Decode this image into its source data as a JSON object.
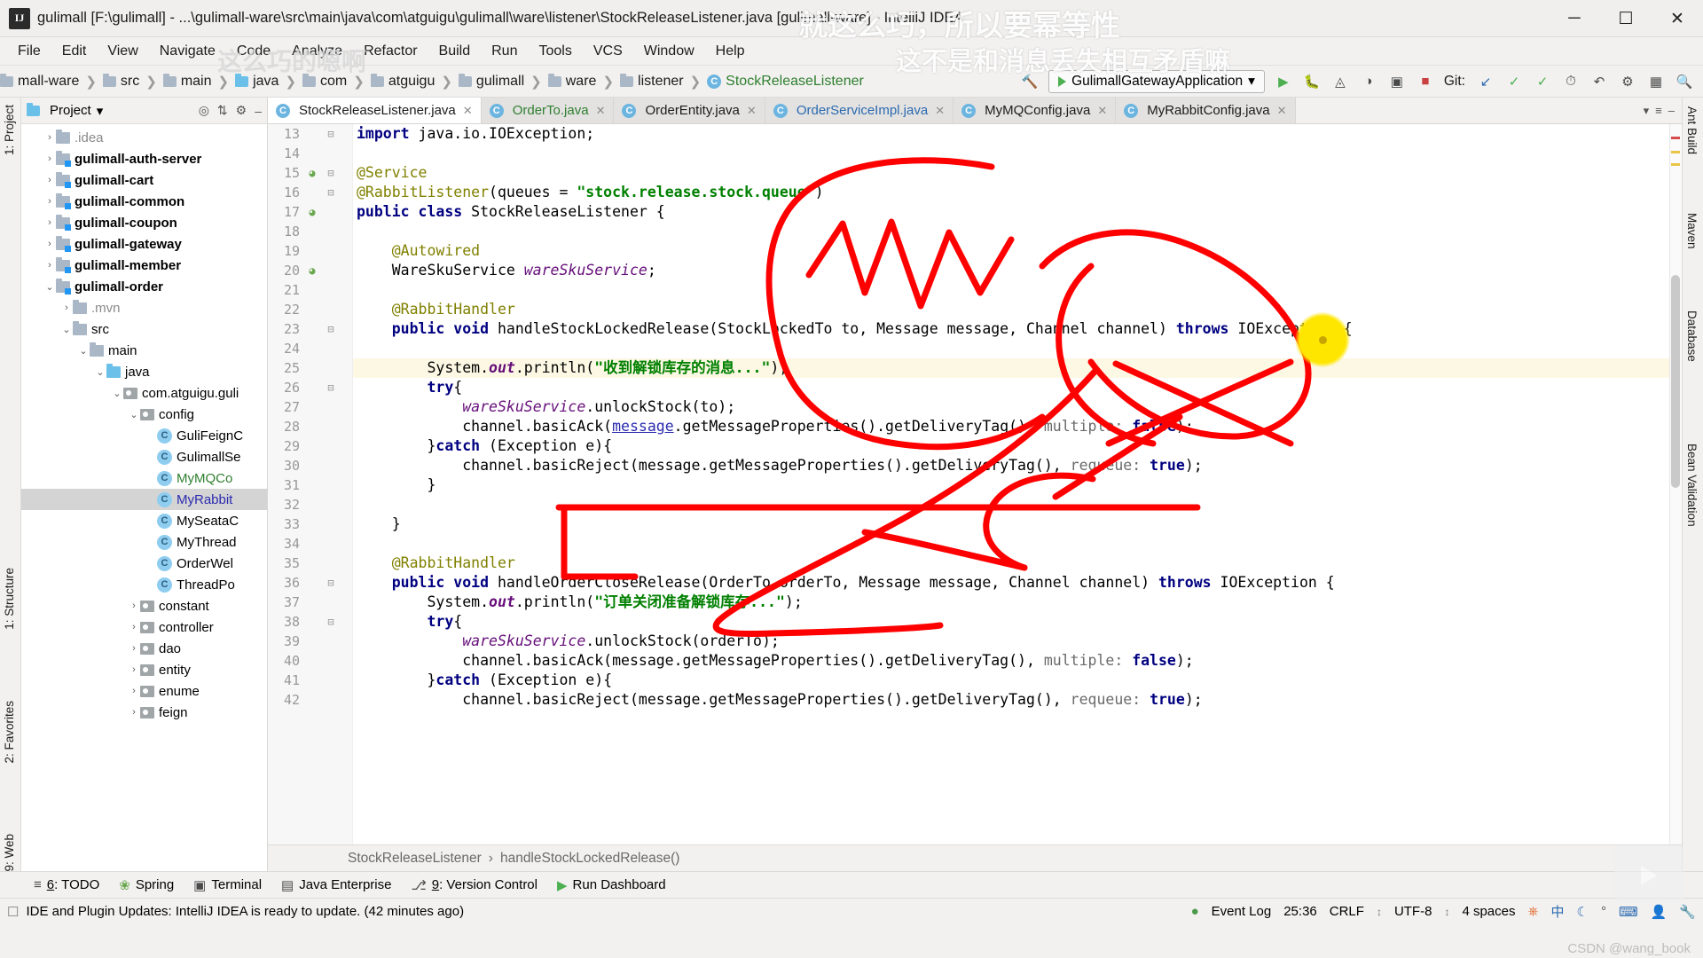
{
  "window": {
    "title": "gulimall [F:\\gulimall] - ...\\gulimall-ware\\src\\main\\java\\com\\atguigu\\gulimall\\ware\\listener\\StockReleaseListener.java [gulimall-ware] - IntelliJ IDEA",
    "logo": "IJ",
    "minimize": "─",
    "maximize": "☐",
    "close": "✕"
  },
  "menubar": [
    {
      "label": "File"
    },
    {
      "label": "Edit"
    },
    {
      "label": "View"
    },
    {
      "label": "Navigate"
    },
    {
      "label": "Code"
    },
    {
      "label": "Analyze"
    },
    {
      "label": "Refactor"
    },
    {
      "label": "Build"
    },
    {
      "label": "Run"
    },
    {
      "label": "Tools"
    },
    {
      "label": "VCS"
    },
    {
      "label": "Window"
    },
    {
      "label": "Help"
    }
  ],
  "breadcrumb": {
    "items": [
      {
        "label": "mall-ware",
        "icon": "module-folder-icon"
      },
      {
        "label": "src",
        "icon": "folder-icon"
      },
      {
        "label": "main",
        "icon": "folder-icon"
      },
      {
        "label": "java",
        "icon": "source-folder-icon"
      },
      {
        "label": "com",
        "icon": "package-icon"
      },
      {
        "label": "atguigu",
        "icon": "package-icon"
      },
      {
        "label": "gulimall",
        "icon": "package-icon"
      },
      {
        "label": "ware",
        "icon": "package-icon"
      },
      {
        "label": "listener",
        "icon": "package-icon"
      },
      {
        "label": "StockReleaseListener",
        "icon": "class-icon"
      }
    ],
    "separator": "❯"
  },
  "toolbar": {
    "run_config": "GulimallGatewayApplication",
    "run_config_dropdown": "▾",
    "build_icon": "hammer-icon",
    "run_icon": "run-icon",
    "debug_icon": "debug-icon",
    "coverage_icon": "coverage-icon",
    "profile_icon": "profile-icon",
    "stop_icon": "stop-icon",
    "git_label": "Git:",
    "update_icon": "update-project-icon",
    "commit_icon": "commit-icon",
    "push_icon": "push-icon",
    "history_icon": "history-icon",
    "revert_icon": "revert-icon",
    "settings_icon": "settings-icon",
    "layout_icon": "layout-icon",
    "search_icon": "search-icon"
  },
  "left_strip": [
    {
      "label": "1: Project"
    },
    {
      "label": "1: Structure"
    },
    {
      "label": "2: Favorites"
    },
    {
      "label": "9: Web"
    }
  ],
  "right_strip": [
    {
      "label": "Ant Build"
    },
    {
      "label": "Maven"
    },
    {
      "label": "Database"
    },
    {
      "label": "Bean Validation"
    }
  ],
  "project_panel": {
    "title": "Project",
    "title_dropdown": "▾",
    "locate_icon": "locate-icon",
    "collapse_icon": "collapse-all-icon",
    "gear_icon": "gear-icon",
    "hide_icon": "hide-icon",
    "tree": [
      {
        "label": ".idea",
        "indent": 1,
        "arrow": "›",
        "icon": "folder-icon",
        "style": "grey"
      },
      {
        "label": "gulimall-auth-server",
        "indent": 1,
        "arrow": "›",
        "icon": "module-icon",
        "style": "bold"
      },
      {
        "label": "gulimall-cart",
        "indent": 1,
        "arrow": "›",
        "icon": "module-icon",
        "style": "bold"
      },
      {
        "label": "gulimall-common",
        "indent": 1,
        "arrow": "›",
        "icon": "module-icon",
        "style": "bold"
      },
      {
        "label": "gulimall-coupon",
        "indent": 1,
        "arrow": "›",
        "icon": "module-icon",
        "style": "bold"
      },
      {
        "label": "gulimall-gateway",
        "indent": 1,
        "arrow": "›",
        "icon": "module-icon",
        "style": "bold"
      },
      {
        "label": "gulimall-member",
        "indent": 1,
        "arrow": "›",
        "icon": "module-icon",
        "style": "bold"
      },
      {
        "label": "gulimall-order",
        "indent": 1,
        "arrow": "⌄",
        "icon": "module-icon",
        "style": "bold"
      },
      {
        "label": ".mvn",
        "indent": 2,
        "arrow": "›",
        "icon": "folder-icon",
        "style": "grey"
      },
      {
        "label": "src",
        "indent": 2,
        "arrow": "⌄",
        "icon": "folder-icon",
        "style": "normal"
      },
      {
        "label": "main",
        "indent": 3,
        "arrow": "⌄",
        "icon": "folder-icon",
        "style": "normal"
      },
      {
        "label": "java",
        "indent": 4,
        "arrow": "⌄",
        "icon": "source-folder-icon",
        "style": "normal"
      },
      {
        "label": "com.atguigu.guli",
        "indent": 5,
        "arrow": "⌄",
        "icon": "package-icon",
        "style": "normal"
      },
      {
        "label": "config",
        "indent": 6,
        "arrow": "⌄",
        "icon": "package-icon",
        "style": "normal"
      },
      {
        "label": "GuliFeignC",
        "indent": 7,
        "arrow": "",
        "icon": "class-icon",
        "style": "normal"
      },
      {
        "label": "GulimallSe",
        "indent": 7,
        "arrow": "",
        "icon": "class-icon",
        "style": "normal"
      },
      {
        "label": "MyMQCo",
        "indent": 7,
        "arrow": "",
        "icon": "class-icon",
        "style": "green"
      },
      {
        "label": "MyRabbit",
        "indent": 7,
        "arrow": "",
        "icon": "class-icon",
        "style": "blue",
        "selected": true
      },
      {
        "label": "MySeataC",
        "indent": 7,
        "arrow": "",
        "icon": "class-icon",
        "style": "normal"
      },
      {
        "label": "MyThread",
        "indent": 7,
        "arrow": "",
        "icon": "class-icon",
        "style": "normal"
      },
      {
        "label": "OrderWel",
        "indent": 7,
        "arrow": "",
        "icon": "class-icon",
        "style": "normal"
      },
      {
        "label": "ThreadPo",
        "indent": 7,
        "arrow": "",
        "icon": "class-icon",
        "style": "normal"
      },
      {
        "label": "constant",
        "indent": 6,
        "arrow": "›",
        "icon": "package-icon",
        "style": "normal"
      },
      {
        "label": "controller",
        "indent": 6,
        "arrow": "›",
        "icon": "package-icon",
        "style": "normal"
      },
      {
        "label": "dao",
        "indent": 6,
        "arrow": "›",
        "icon": "package-icon",
        "style": "normal"
      },
      {
        "label": "entity",
        "indent": 6,
        "arrow": "›",
        "icon": "package-icon",
        "style": "normal"
      },
      {
        "label": "enume",
        "indent": 6,
        "arrow": "›",
        "icon": "package-icon",
        "style": "normal"
      },
      {
        "label": "feign",
        "indent": 6,
        "arrow": "›",
        "icon": "package-icon",
        "style": "normal"
      }
    ]
  },
  "editor_tabs": [
    {
      "label": "StockReleaseListener.java",
      "active": true,
      "color": "normal",
      "close": "✕"
    },
    {
      "label": "OrderTo.java",
      "active": false,
      "color": "green",
      "close": "✕"
    },
    {
      "label": "OrderEntity.java",
      "active": false,
      "color": "normal",
      "close": "✕"
    },
    {
      "label": "OrderServiceImpl.java",
      "active": false,
      "color": "blue",
      "close": "✕"
    },
    {
      "label": "MyMQConfig.java",
      "active": false,
      "color": "normal",
      "close": "✕"
    },
    {
      "label": "MyRabbitConfig.java",
      "active": false,
      "color": "normal",
      "close": "✕"
    }
  ],
  "code": {
    "first_line_number": 13,
    "lines": [
      {
        "n": 13,
        "mark": "",
        "fold": "−",
        "highlight": false,
        "tokens": [
          {
            "t": "import ",
            "c": "kw"
          },
          {
            "t": "java.io.IOException;",
            "c": "plain"
          }
        ]
      },
      {
        "n": 14,
        "mark": "",
        "fold": "",
        "highlight": false,
        "tokens": []
      },
      {
        "n": 15,
        "mark": "bean-icon",
        "fold": "−",
        "highlight": false,
        "tokens": [
          {
            "t": "@Service",
            "c": "ann"
          }
        ]
      },
      {
        "n": 16,
        "mark": "",
        "fold": "−",
        "highlight": false,
        "tokens": [
          {
            "t": "@RabbitListener",
            "c": "ann"
          },
          {
            "t": "(queues = ",
            "c": "plain"
          },
          {
            "t": "\"stock.release.stock.queue\"",
            "c": "str"
          },
          {
            "t": ")",
            "c": "plain"
          }
        ]
      },
      {
        "n": 17,
        "mark": "bean-icon",
        "fold": "",
        "highlight": false,
        "tokens": [
          {
            "t": "public class ",
            "c": "kw"
          },
          {
            "t": "StockReleaseListener {",
            "c": "plain"
          }
        ]
      },
      {
        "n": 18,
        "mark": "",
        "fold": "",
        "highlight": false,
        "tokens": []
      },
      {
        "n": 19,
        "mark": "",
        "fold": "",
        "highlight": false,
        "tokens": [
          {
            "t": "    @Autowired",
            "c": "ann"
          }
        ]
      },
      {
        "n": 20,
        "mark": "bean-icon",
        "fold": "",
        "highlight": false,
        "tokens": [
          {
            "t": "    WareSkuService ",
            "c": "plain"
          },
          {
            "t": "wareSkuService",
            "c": "fld"
          },
          {
            "t": ";",
            "c": "plain"
          }
        ]
      },
      {
        "n": 21,
        "mark": "",
        "fold": "",
        "highlight": false,
        "tokens": []
      },
      {
        "n": 22,
        "mark": "",
        "fold": "",
        "highlight": false,
        "tokens": [
          {
            "t": "    @RabbitHandler",
            "c": "ann"
          }
        ]
      },
      {
        "n": 23,
        "mark": "",
        "fold": "−",
        "highlight": false,
        "tokens": [
          {
            "t": "    public void ",
            "c": "kw"
          },
          {
            "t": "handleStockLockedRelease(StockLockedTo to, Message message, Channel channel) ",
            "c": "plain"
          },
          {
            "t": "throws ",
            "c": "kw"
          },
          {
            "t": "IOException {",
            "c": "plain"
          }
        ]
      },
      {
        "n": 24,
        "mark": "",
        "fold": "",
        "highlight": false,
        "tokens": []
      },
      {
        "n": 25,
        "mark": "",
        "fold": "",
        "highlight": true,
        "tokens": [
          {
            "t": "        System.",
            "c": "plain"
          },
          {
            "t": "out",
            "c": "sf"
          },
          {
            "t": ".println(",
            "c": "plain"
          },
          {
            "t": "\"收到解锁库存的消息...\"",
            "c": "str"
          },
          {
            "t": ");",
            "c": "plain"
          }
        ]
      },
      {
        "n": 26,
        "mark": "",
        "fold": "−",
        "highlight": false,
        "tokens": [
          {
            "t": "        try",
            "c": "kw"
          },
          {
            "t": "{",
            "c": "plain"
          }
        ]
      },
      {
        "n": 27,
        "mark": "",
        "fold": "",
        "highlight": false,
        "tokens": [
          {
            "t": "            ",
            "c": "plain"
          },
          {
            "t": "wareSkuService",
            "c": "fld"
          },
          {
            "t": ".unlockStock(to);",
            "c": "plain"
          }
        ]
      },
      {
        "n": 28,
        "mark": "",
        "fold": "",
        "highlight": false,
        "tokens": [
          {
            "t": "            channel.basicAck(",
            "c": "plain"
          },
          {
            "t": "message",
            "c": "lnk"
          },
          {
            "t": ".getMessageProperties().getDeliveryTag(), ",
            "c": "plain"
          },
          {
            "t": "multiple: ",
            "c": "param"
          },
          {
            "t": "false",
            "c": "kw"
          },
          {
            "t": ");",
            "c": "plain"
          }
        ]
      },
      {
        "n": 29,
        "mark": "",
        "fold": "",
        "highlight": false,
        "tokens": [
          {
            "t": "        }",
            "c": "plain"
          },
          {
            "t": "catch ",
            "c": "kw"
          },
          {
            "t": "(Exception e){",
            "c": "plain"
          }
        ]
      },
      {
        "n": 30,
        "mark": "",
        "fold": "",
        "highlight": false,
        "tokens": [
          {
            "t": "            channel.basicReject(message.getMessageProperties().getDeliveryTag(), ",
            "c": "plain"
          },
          {
            "t": "requeue: ",
            "c": "param"
          },
          {
            "t": "true",
            "c": "kw"
          },
          {
            "t": ");",
            "c": "plain"
          }
        ]
      },
      {
        "n": 31,
        "mark": "",
        "fold": "",
        "highlight": false,
        "tokens": [
          {
            "t": "        }",
            "c": "plain"
          }
        ]
      },
      {
        "n": 32,
        "mark": "",
        "fold": "",
        "highlight": false,
        "tokens": []
      },
      {
        "n": 33,
        "mark": "",
        "fold": "",
        "highlight": false,
        "tokens": [
          {
            "t": "    }",
            "c": "plain"
          }
        ]
      },
      {
        "n": 34,
        "mark": "",
        "fold": "",
        "highlight": false,
        "tokens": []
      },
      {
        "n": 35,
        "mark": "",
        "fold": "",
        "highlight": false,
        "tokens": [
          {
            "t": "    @RabbitHandler",
            "c": "ann"
          }
        ]
      },
      {
        "n": 36,
        "mark": "",
        "fold": "−",
        "highlight": false,
        "tokens": [
          {
            "t": "    public void ",
            "c": "kw"
          },
          {
            "t": "handleOrderCloseRelease(OrderTo orderTo, Message message, Channel channel) ",
            "c": "plain"
          },
          {
            "t": "throws ",
            "c": "kw"
          },
          {
            "t": "IOException {",
            "c": "plain"
          }
        ]
      },
      {
        "n": 37,
        "mark": "",
        "fold": "",
        "highlight": false,
        "tokens": [
          {
            "t": "        System.",
            "c": "plain"
          },
          {
            "t": "out",
            "c": "sf"
          },
          {
            "t": ".println(",
            "c": "plain"
          },
          {
            "t": "\"订单关闭准备解锁库存...\"",
            "c": "str"
          },
          {
            "t": ");",
            "c": "plain"
          }
        ]
      },
      {
        "n": 38,
        "mark": "",
        "fold": "−",
        "highlight": false,
        "tokens": [
          {
            "t": "        try",
            "c": "kw"
          },
          {
            "t": "{",
            "c": "plain"
          }
        ]
      },
      {
        "n": 39,
        "mark": "",
        "fold": "",
        "highlight": false,
        "tokens": [
          {
            "t": "            ",
            "c": "plain"
          },
          {
            "t": "wareSkuService",
            "c": "fld"
          },
          {
            "t": ".unlockStock(orderTo);",
            "c": "plain"
          }
        ]
      },
      {
        "n": 40,
        "mark": "",
        "fold": "",
        "highlight": false,
        "tokens": [
          {
            "t": "            channel.basicAck(message.getMessageProperties().getDeliveryTag(), ",
            "c": "plain"
          },
          {
            "t": "multiple: ",
            "c": "param"
          },
          {
            "t": "false",
            "c": "kw"
          },
          {
            "t": ");",
            "c": "plain"
          }
        ]
      },
      {
        "n": 41,
        "mark": "",
        "fold": "",
        "highlight": false,
        "tokens": [
          {
            "t": "        }",
            "c": "plain"
          },
          {
            "t": "catch ",
            "c": "kw"
          },
          {
            "t": "(Exception e){",
            "c": "plain"
          }
        ]
      },
      {
        "n": 42,
        "mark": "",
        "fold": "",
        "highlight": false,
        "tokens": [
          {
            "t": "            channel.basicReject(message.getMessageProperties().getDeliveryTag(), ",
            "c": "plain"
          },
          {
            "t": "requeue: ",
            "c": "param"
          },
          {
            "t": "true",
            "c": "kw"
          },
          {
            "t": ");",
            "c": "plain"
          }
        ]
      }
    ]
  },
  "editor_breadcrumb": {
    "class": "StockReleaseListener",
    "separator": "›",
    "method": "handleStockLockedRelease()"
  },
  "tool_windows": [
    {
      "label": "6: TODO",
      "num": "6",
      "text": ": TODO",
      "icon": "todo-icon"
    },
    {
      "label": "Spring",
      "num": "",
      "text": "Spring",
      "icon": "spring-icon"
    },
    {
      "label": "Terminal",
      "num": "",
      "text": "Terminal",
      "icon": "terminal-icon"
    },
    {
      "label": "Java Enterprise",
      "num": "",
      "text": "Java Enterprise",
      "icon": "java-enterprise-icon"
    },
    {
      "label": "9: Version Control",
      "num": "9",
      "text": ": Version Control",
      "icon": "version-control-icon"
    },
    {
      "label": "Run Dashboard",
      "num": "",
      "text": "Run Dashboard",
      "icon": "run-dashboard-icon"
    }
  ],
  "statusbar": {
    "message": "IDE and Plugin Updates: IntelliJ IDEA is ready to update. (42 minutes ago)",
    "event_log": "Event Log",
    "caret": "25:36",
    "line_separator": "CRLF",
    "encoding": "UTF-8",
    "indent": "4 spaces",
    "selector": "↕",
    "ime": "中",
    "tray_icons": [
      "ubuntu-icon",
      "ime-icon",
      "moon-icon",
      "degree-icon",
      "keyboard-icon",
      "user-icon",
      "wrench-icon"
    ]
  },
  "watermarks": {
    "top": "就这么巧，所以要幂等性",
    "second": "这不是和消息丢失相互矛盾嘛",
    "grey": "这么巧的嗯啊",
    "credit": "CSDN @wang_book"
  },
  "colors": {
    "accent": "#2b6ab0",
    "annotation_red": "#ff0000",
    "highlight_yellow": "#ffe600",
    "keyword": "#000080",
    "string": "#008000",
    "annotation": "#808000"
  }
}
